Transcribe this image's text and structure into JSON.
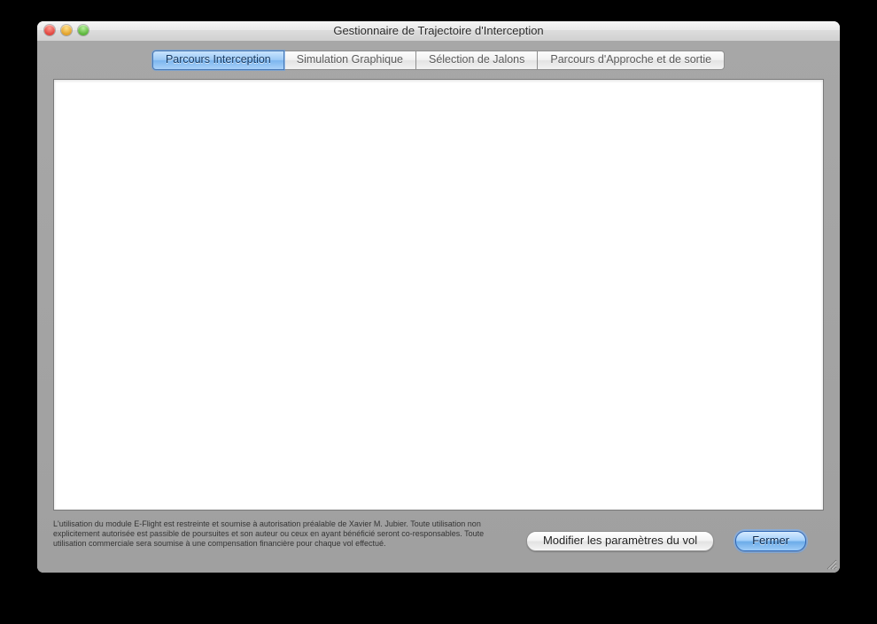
{
  "window": {
    "title": "Gestionnaire de Trajectoire d'Interception"
  },
  "tabs": [
    {
      "label": "Parcours Interception",
      "active": true
    },
    {
      "label": "Simulation Graphique",
      "active": false
    },
    {
      "label": "Sélection de Jalons",
      "active": false
    },
    {
      "label": "Parcours d'Approche et de sortie",
      "active": false
    }
  ],
  "footer": {
    "disclaimer": "L'utilisation du module E-Flight est restreinte et soumise à autorisation préalable de Xavier M. Jubier. Toute utilisation non explicitement autorisée est passible de poursuites et son auteur ou ceux en ayant bénéficié seront co-responsables. Toute utilisation commerciale sera soumise à une compensation financière pour chaque vol effectué.",
    "modify_label": "Modifier les paramètres du vol",
    "close_label": "Fermer"
  }
}
